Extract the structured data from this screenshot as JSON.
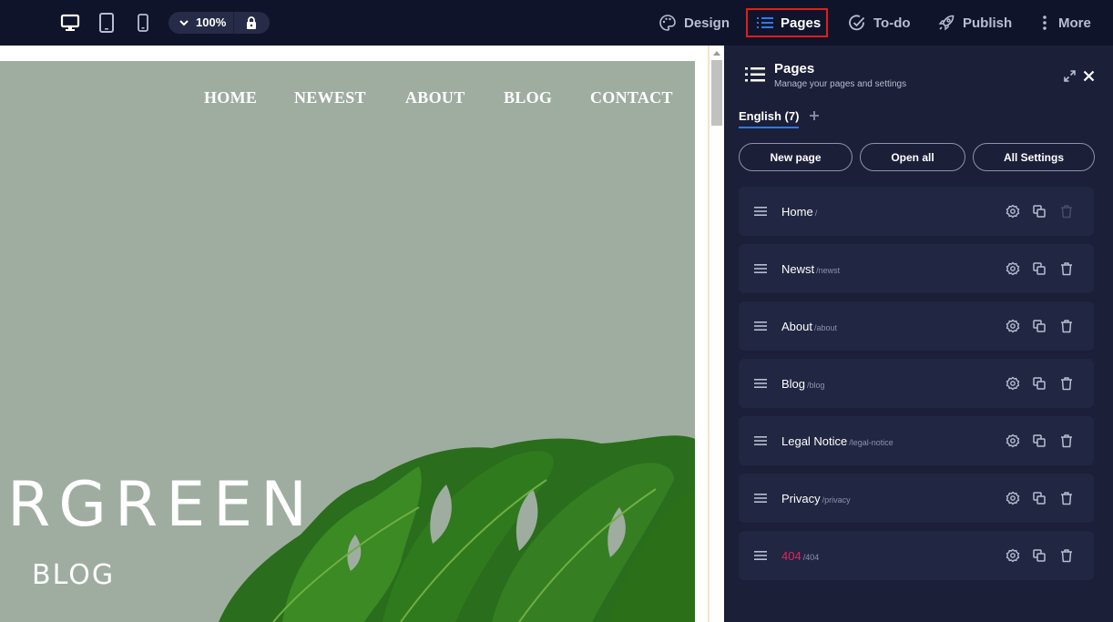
{
  "topbar": {
    "zoom": "100%",
    "nav": [
      {
        "label": "Design",
        "icon": "palette-icon"
      },
      {
        "label": "Pages",
        "icon": "list-icon",
        "active": true
      },
      {
        "label": "To-do",
        "icon": "check-circle-icon"
      },
      {
        "label": "Publish",
        "icon": "rocket-icon"
      },
      {
        "label": "More",
        "icon": "kebab-icon"
      }
    ]
  },
  "site": {
    "nav": [
      "HOME",
      "NEWEST",
      "ABOUT",
      "BLOG",
      "CONTACT"
    ],
    "hero_title": "RGREEN",
    "hero_sub": "BLOG"
  },
  "panel": {
    "title": "Pages",
    "subtitle": "Manage your pages and settings",
    "language_tab": "English (7)",
    "buttons": {
      "new_page": "New page",
      "open_all": "Open all",
      "all_settings": "All Settings"
    },
    "pages": [
      {
        "name": "Home",
        "slug": "/"
      },
      {
        "name": "Newst",
        "slug": "/newst"
      },
      {
        "name": "About",
        "slug": "/about"
      },
      {
        "name": "Blog",
        "slug": "/blog"
      },
      {
        "name": "Legal Notice",
        "slug": "/legal-notice"
      },
      {
        "name": "Privacy",
        "slug": "/privacy"
      },
      {
        "name": "404",
        "slug": "/404"
      }
    ]
  },
  "colors": {
    "accent": "#2b7bff",
    "highlight": "#e01e1e",
    "error_page": "#e0245e",
    "hero_bg": "#9fada0"
  }
}
